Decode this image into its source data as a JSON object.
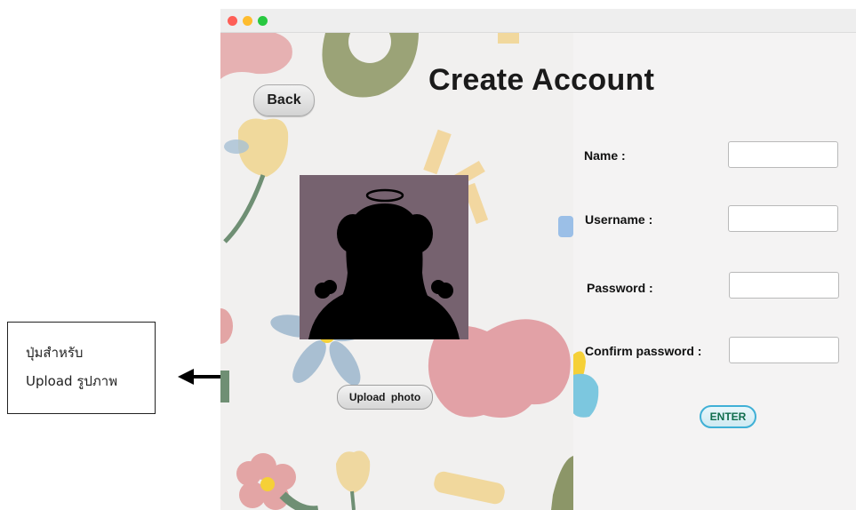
{
  "annotation": {
    "line1": "ปุ่มสำหรับ",
    "line2": "Upload รูปภาพ"
  },
  "window": {
    "back_label": "Back",
    "title": "Create Account",
    "upload_label": "Upload photo",
    "enter_label": "ENTER",
    "form": {
      "name_label": "Name :",
      "username_label": "Username :",
      "password_label": "Password :",
      "confirm_label": "Confirm password :"
    }
  },
  "colors": {
    "photo_bg": "#76626f",
    "enter_border": "#3fb0d6",
    "enter_text": "#0f6d4d"
  }
}
